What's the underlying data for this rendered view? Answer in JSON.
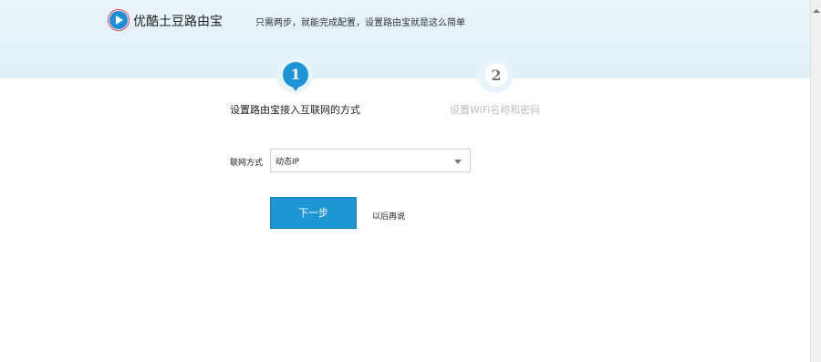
{
  "header": {
    "brand": "优酷土豆路由宝",
    "tagline": "只需两步，就能完成配置，设置路由宝就是这么简单"
  },
  "steps": [
    {
      "number": "1",
      "label": "设置路由宝接入互联网的方式",
      "active": true
    },
    {
      "number": "2",
      "label": "设置WiFi名称和密码",
      "active": false
    }
  ],
  "form": {
    "connection_label": "联网方式",
    "connection_value": "动态IP"
  },
  "actions": {
    "next_label": "下一步",
    "later_label": "以后再说"
  },
  "colors": {
    "accent": "#1e93d7",
    "header_bg": "#e3f2f9",
    "inactive_text": "#bdbdbd"
  },
  "icons": {
    "logo": "play-logo-icon",
    "dropdown": "chevron-down-icon",
    "scroll": "scroll-up-arrow-icon"
  }
}
